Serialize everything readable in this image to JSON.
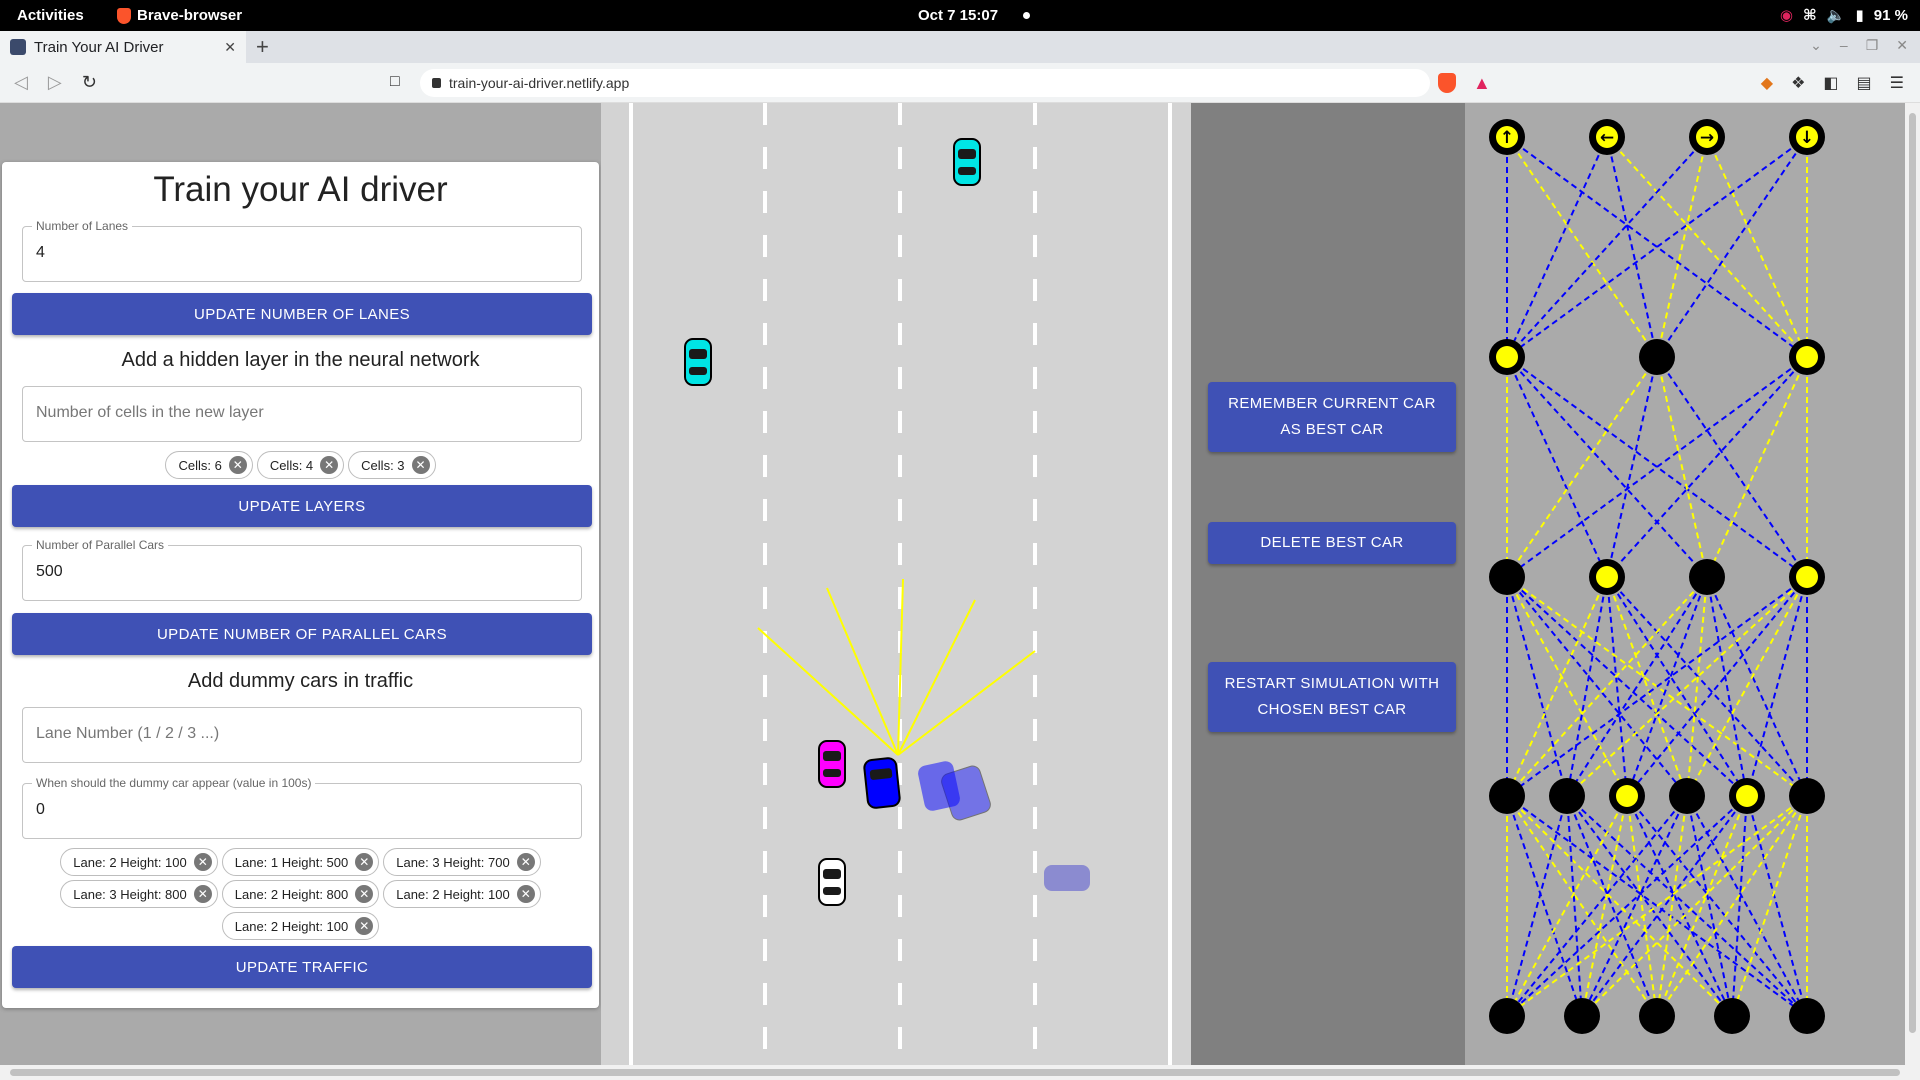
{
  "system": {
    "activities": "Activities",
    "app_name": "Brave-browser",
    "clock": "Oct 7  15:07",
    "battery": "91 %"
  },
  "browser": {
    "tab_title": "Train Your AI Driver",
    "url": "train-your-ai-driver.netlify.app"
  },
  "panel": {
    "title": "Train your AI driver",
    "lanes": {
      "label": "Number of Lanes",
      "value": "4",
      "button": "UPDATE NUMBER OF LANES"
    },
    "layers": {
      "heading": "Add a hidden layer in the neural network",
      "placeholder": "Number of cells in the new layer",
      "chips": [
        "Cells: 6",
        "Cells: 4",
        "Cells: 3"
      ],
      "button": "UPDATE LAYERS"
    },
    "parallel": {
      "label": "Number of Parallel Cars",
      "value": "500",
      "button": "UPDATE NUMBER OF PARALLEL CARS"
    },
    "traffic": {
      "heading": "Add dummy cars in traffic",
      "lane_placeholder": "Lane Number (1 / 2 / 3 ...)",
      "appear_label": "When should the dummy car appear (value in 100s)",
      "appear_value": "0",
      "chips": [
        "Lane: 2 Height: 100",
        "Lane: 1 Height: 500",
        "Lane: 3 Height: 700",
        "Lane: 3 Height: 800",
        "Lane: 2 Height: 800",
        "Lane: 2 Height: 100",
        "Lane: 2 Height: 100"
      ],
      "button": "UPDATE TRAFFIC"
    }
  },
  "controls": {
    "remember": "REMEMBER CURRENT CAR AS BEST CAR",
    "delete": "DELETE BEST CAR",
    "restart": "RESTART SIMULATION WITH CHOSEN BEST CAR"
  },
  "colors": {
    "primary": "#3f51b5",
    "road": "#d3d3d3",
    "sensor": "#ffff00",
    "ai_car": "#0000ff",
    "traffic_car": "#00ffff",
    "best_car": "#ff00ff",
    "positive_weight": "#ffff00",
    "negative_weight": "#0000ff"
  },
  "icons": [
    "brave-lion-icon",
    "wifi-icon",
    "volume-icon",
    "battery-icon",
    "bookmark-icon",
    "lock-icon",
    "brave-shields-icon",
    "rewards-icon",
    "puzzle-icon",
    "sidebar-icon",
    "wallet-icon",
    "menu-icon",
    "arrow-up-icon",
    "arrow-left-icon",
    "arrow-right-icon",
    "arrow-down-icon"
  ]
}
